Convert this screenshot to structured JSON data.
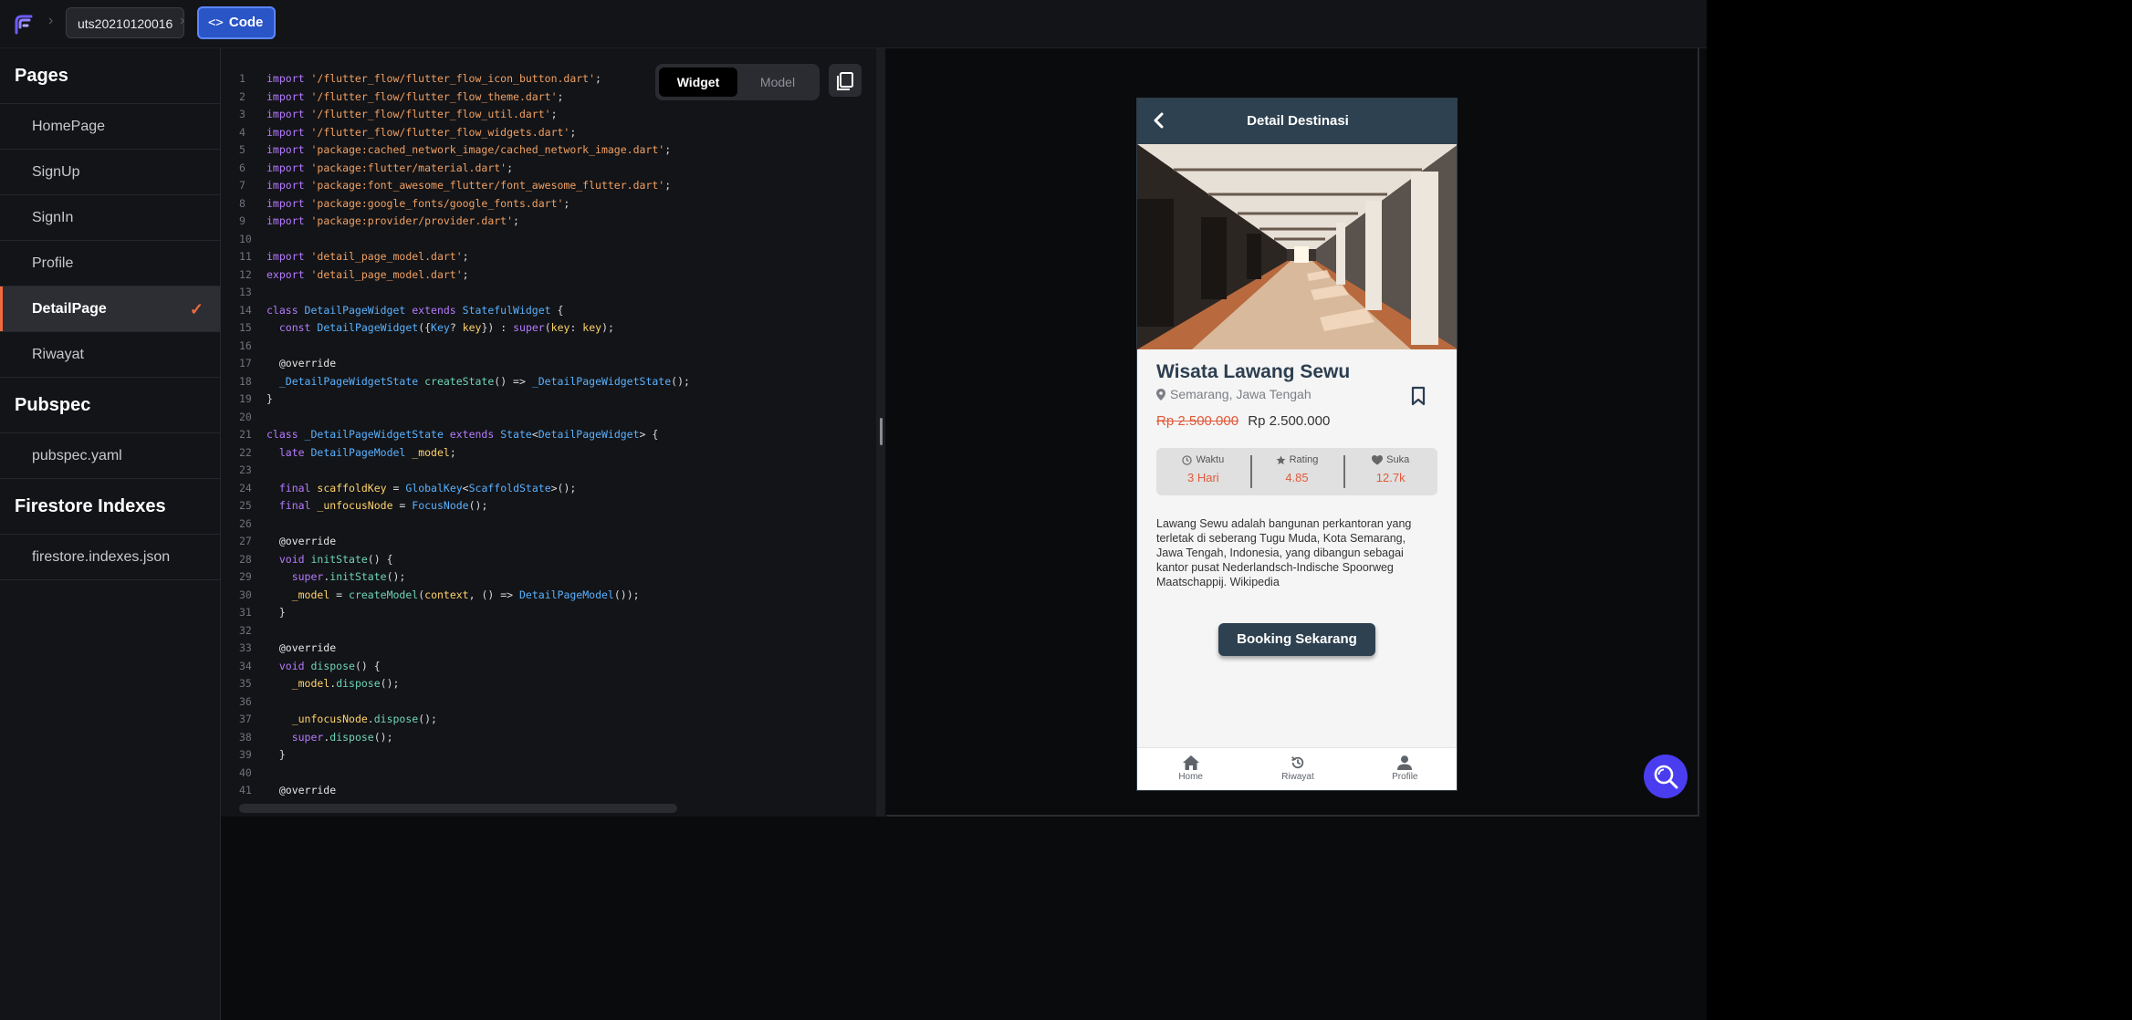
{
  "header": {
    "project_name": "uts20210120016",
    "code_label": "Code",
    "code_icon": "code-brackets-icon",
    "accent": "#2a55c7"
  },
  "sidebar": {
    "sections": [
      {
        "title": "Pages",
        "items": [
          {
            "label": "HomePage",
            "active": false
          },
          {
            "label": "SignUp",
            "active": false
          },
          {
            "label": "SignIn",
            "active": false
          },
          {
            "label": "Profile",
            "active": false
          },
          {
            "label": "DetailPage",
            "active": true
          },
          {
            "label": "Riwayat",
            "active": false
          }
        ]
      },
      {
        "title": "Pubspec",
        "items": [
          {
            "label": "pubspec.yaml",
            "active": false
          }
        ]
      },
      {
        "title": "Firestore Indexes",
        "items": [
          {
            "label": "firestore.indexes.json",
            "active": false
          }
        ]
      }
    ],
    "active_color": "#f26a3d"
  },
  "code_view": {
    "toggle": {
      "widget_label": "Widget",
      "model_label": "Model",
      "selected": "Widget"
    },
    "lines": [
      [
        [
          "kw",
          "import "
        ],
        [
          "str",
          "'/flutter_flow/flutter_flow_icon_button.dart'"
        ],
        [
          "t",
          ";"
        ]
      ],
      [
        [
          "kw",
          "import "
        ],
        [
          "str",
          "'/flutter_flow/flutter_flow_theme.dart'"
        ],
        [
          "t",
          ";"
        ]
      ],
      [
        [
          "kw",
          "import "
        ],
        [
          "str",
          "'/flutter_flow/flutter_flow_util.dart'"
        ],
        [
          "t",
          ";"
        ]
      ],
      [
        [
          "kw",
          "import "
        ],
        [
          "str",
          "'/flutter_flow/flutter_flow_widgets.dart'"
        ],
        [
          "t",
          ";"
        ]
      ],
      [
        [
          "kw",
          "import "
        ],
        [
          "str",
          "'package:cached_network_image/cached_network_image.dart'"
        ],
        [
          "t",
          ";"
        ]
      ],
      [
        [
          "kw",
          "import "
        ],
        [
          "str",
          "'package:flutter/material.dart'"
        ],
        [
          "t",
          ";"
        ]
      ],
      [
        [
          "kw",
          "import "
        ],
        [
          "str",
          "'package:font_awesome_flutter/font_awesome_flutter.dart'"
        ],
        [
          "t",
          ";"
        ]
      ],
      [
        [
          "kw",
          "import "
        ],
        [
          "str",
          "'package:google_fonts/google_fonts.dart'"
        ],
        [
          "t",
          ";"
        ]
      ],
      [
        [
          "kw",
          "import "
        ],
        [
          "str",
          "'package:provider/provider.dart'"
        ],
        [
          "t",
          ";"
        ]
      ],
      [],
      [
        [
          "kw",
          "import "
        ],
        [
          "str",
          "'detail_page_model.dart'"
        ],
        [
          "t",
          ";"
        ]
      ],
      [
        [
          "kw",
          "export "
        ],
        [
          "str",
          "'detail_page_model.dart'"
        ],
        [
          "t",
          ";"
        ]
      ],
      [],
      [
        [
          "kw",
          "class "
        ],
        [
          "cls",
          "DetailPageWidget "
        ],
        [
          "kw",
          "extends "
        ],
        [
          "cls",
          "StatefulWidget"
        ],
        [
          "t",
          " {"
        ]
      ],
      [
        [
          "t",
          "  "
        ],
        [
          "kw",
          "const "
        ],
        [
          "cls",
          "DetailPageWidget"
        ],
        [
          "t",
          "({"
        ],
        [
          "cls",
          "Key"
        ],
        [
          "t",
          "? "
        ],
        [
          "var",
          "key"
        ],
        [
          "t",
          "}) : "
        ],
        [
          "kw",
          "super"
        ],
        [
          "t",
          "("
        ],
        [
          "var",
          "key"
        ],
        [
          "t",
          ": "
        ],
        [
          "var",
          "key"
        ],
        [
          "t",
          ");"
        ]
      ],
      [],
      [
        [
          "ann",
          "  @override"
        ]
      ],
      [
        [
          "t",
          "  "
        ],
        [
          "cls",
          "_DetailPageWidgetState "
        ],
        [
          "fn",
          "createState"
        ],
        [
          "t",
          "() => "
        ],
        [
          "cls",
          "_DetailPageWidgetState"
        ],
        [
          "t",
          "();"
        ]
      ],
      [
        [
          "t",
          "}"
        ]
      ],
      [],
      [
        [
          "kw",
          "class "
        ],
        [
          "cls",
          "_DetailPageWidgetState "
        ],
        [
          "kw",
          "extends "
        ],
        [
          "cls",
          "State"
        ],
        [
          "t",
          "<"
        ],
        [
          "cls",
          "DetailPageWidget"
        ],
        [
          "t",
          "> {"
        ]
      ],
      [
        [
          "t",
          "  "
        ],
        [
          "kw",
          "late "
        ],
        [
          "cls",
          "DetailPageModel "
        ],
        [
          "var",
          "_model"
        ],
        [
          "t",
          ";"
        ]
      ],
      [],
      [
        [
          "t",
          "  "
        ],
        [
          "kw",
          "final "
        ],
        [
          "var",
          "scaffoldKey "
        ],
        [
          "t",
          "= "
        ],
        [
          "cls",
          "GlobalKey"
        ],
        [
          "t",
          "<"
        ],
        [
          "cls",
          "ScaffoldState"
        ],
        [
          "t",
          ">();"
        ]
      ],
      [
        [
          "t",
          "  "
        ],
        [
          "kw",
          "final "
        ],
        [
          "var",
          "_unfocusNode "
        ],
        [
          "t",
          "= "
        ],
        [
          "cls",
          "FocusNode"
        ],
        [
          "t",
          "();"
        ]
      ],
      [],
      [
        [
          "ann",
          "  @override"
        ]
      ],
      [
        [
          "t",
          "  "
        ],
        [
          "kw",
          "void "
        ],
        [
          "fn",
          "initState"
        ],
        [
          "t",
          "() {"
        ]
      ],
      [
        [
          "t",
          "    "
        ],
        [
          "kw",
          "super"
        ],
        [
          "t",
          "."
        ],
        [
          "fn",
          "initState"
        ],
        [
          "t",
          "();"
        ]
      ],
      [
        [
          "t",
          "    "
        ],
        [
          "var",
          "_model "
        ],
        [
          "t",
          "= "
        ],
        [
          "fn",
          "createModel"
        ],
        [
          "t",
          "("
        ],
        [
          "var",
          "context"
        ],
        [
          "t",
          ", () => "
        ],
        [
          "cls",
          "DetailPageModel"
        ],
        [
          "t",
          "());"
        ]
      ],
      [
        [
          "t",
          "  }"
        ]
      ],
      [],
      [
        [
          "ann",
          "  @override"
        ]
      ],
      [
        [
          "t",
          "  "
        ],
        [
          "kw",
          "void "
        ],
        [
          "fn",
          "dispose"
        ],
        [
          "t",
          "() {"
        ]
      ],
      [
        [
          "t",
          "    "
        ],
        [
          "var",
          "_model"
        ],
        [
          "t",
          "."
        ],
        [
          "fn",
          "dispose"
        ],
        [
          "t",
          "();"
        ]
      ],
      [],
      [
        [
          "t",
          "    "
        ],
        [
          "var",
          "_unfocusNode"
        ],
        [
          "t",
          "."
        ],
        [
          "fn",
          "dispose"
        ],
        [
          "t",
          "();"
        ]
      ],
      [
        [
          "t",
          "    "
        ],
        [
          "kw",
          "super"
        ],
        [
          "t",
          "."
        ],
        [
          "fn",
          "dispose"
        ],
        [
          "t",
          "();"
        ]
      ],
      [
        [
          "t",
          "  }"
        ]
      ],
      [],
      [
        [
          "ann",
          "  @override"
        ]
      ]
    ]
  },
  "preview": {
    "header_title": "Detail Destinasi",
    "place_name": "Wisata Lawang Sewu",
    "location": "Semarang, Jawa Tengah",
    "price_old": "Rp 2.500.000",
    "price_new": "Rp 2.500.000",
    "stats": [
      {
        "label": "Waktu",
        "value": "3 Hari",
        "icon": "clock-icon"
      },
      {
        "label": "Rating",
        "value": "4.85",
        "icon": "star-icon"
      },
      {
        "label": "Suka",
        "value": "12.7k",
        "icon": "heart-icon"
      }
    ],
    "description": "Lawang Sewu adalah bangunan perkantoran yang terletak di seberang Tugu Muda, Kota Semarang, Jawa Tengah, Indonesia, yang dibangun sebagai kantor pusat Nederlandsch-Indische Spoorweg Maatschappij. Wikipedia",
    "booking_label": "Booking Sekarang",
    "nav": [
      {
        "label": "Home",
        "icon": "home-icon"
      },
      {
        "label": "Riwayat",
        "icon": "history-icon"
      },
      {
        "label": "Profile",
        "icon": "person-icon"
      }
    ],
    "header_color": "#2e4150",
    "price_color": "#e05a3a"
  },
  "fab_icon": "search-icon"
}
